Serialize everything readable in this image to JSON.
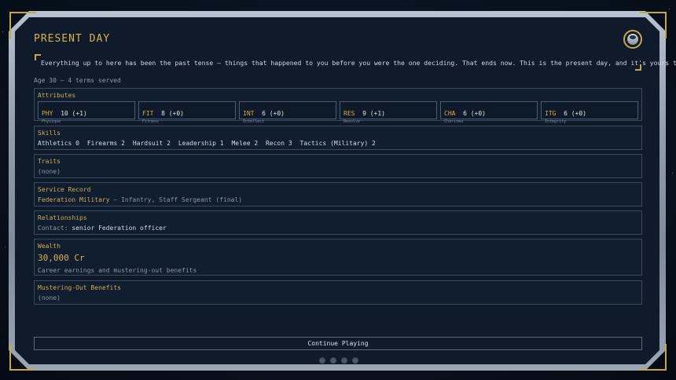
{
  "header": {
    "title": "PRESENT DAY"
  },
  "intro": {
    "text": "Everything up to here has been the past tense — things that happened to you before you were the one deciding. That ends now. This is the present day, and it's yours to write."
  },
  "meta": {
    "age_terms": "Age 30 — 4 terms served"
  },
  "attributes": {
    "label": "Attributes",
    "items": [
      {
        "abbr": "PHY",
        "value": "10 (+1)",
        "name": "Physique"
      },
      {
        "abbr": "FIT",
        "value": "8 (+0)",
        "name": "Fitness"
      },
      {
        "abbr": "INT",
        "value": "6 (+0)",
        "name": "Intellect"
      },
      {
        "abbr": "RES",
        "value": "9 (+1)",
        "name": "Resolve"
      },
      {
        "abbr": "CHA",
        "value": "6 (+0)",
        "name": "Charisma"
      },
      {
        "abbr": "ITG",
        "value": "6 (+0)",
        "name": "Integrity"
      }
    ]
  },
  "skills": {
    "label": "Skills",
    "items": [
      "Athletics 0",
      "Firearms 2",
      "Hardsuit 2",
      "Leadership 1",
      "Melee 2",
      "Recon 3",
      "Tactics (Military) 2"
    ]
  },
  "traits": {
    "label": "Traits",
    "value": "(none)"
  },
  "service": {
    "label": "Service Record",
    "org": "Federation Military",
    "detail": " — Infantry, Staff Sergeant (final)"
  },
  "relationships": {
    "label": "Relationships",
    "prefix": "Contact:",
    "value": "senior Federation officer"
  },
  "wealth": {
    "label": "Wealth",
    "amount": "30,000 Cr",
    "note": "Career earnings and mustering-out benefits"
  },
  "mustering": {
    "label": "Mustering-Out Benefits",
    "value": "(none)"
  },
  "actions": {
    "continue_label": "Continue Playing"
  },
  "icons": {
    "profile": "profile-avatar-icon"
  },
  "colors": {
    "accent": "#d8b24a",
    "panel_border": "#3a4a5e",
    "background": "#0f1b2b"
  }
}
